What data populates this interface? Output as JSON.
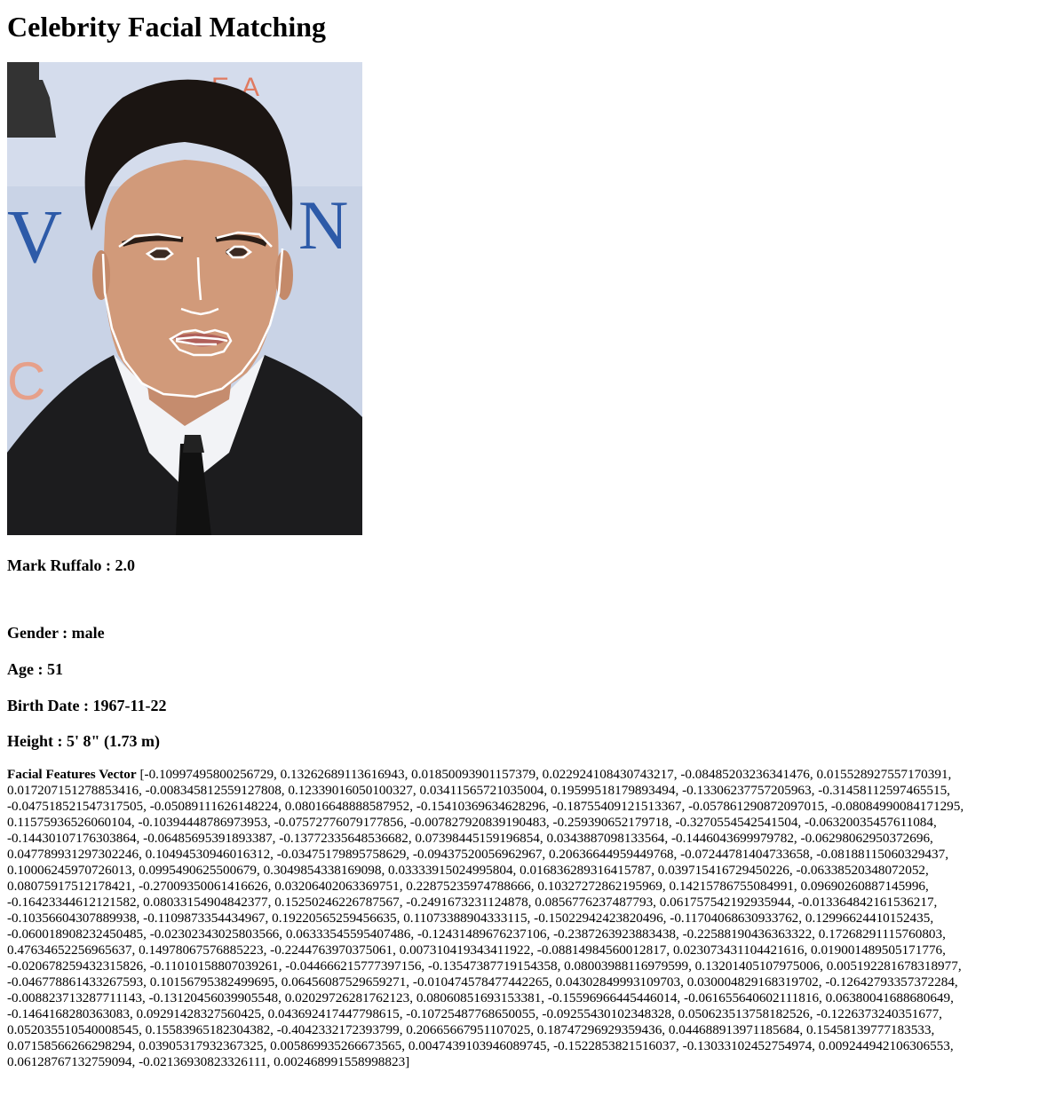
{
  "title": "Celebrity Facial Matching",
  "photo": {
    "alt": "Celebrity photo with facial landmarks",
    "background_text": "EA"
  },
  "match": {
    "name": "Mark Ruffalo",
    "separator": " : ",
    "score": "2.0"
  },
  "gender": {
    "label": "Gender",
    "value": "male"
  },
  "age": {
    "label": "Age",
    "value": "51"
  },
  "birth_date": {
    "label": "Birth Date",
    "value": "1967-11-22"
  },
  "height": {
    "label": "Height",
    "value": "5' 8\" (1.73 m)"
  },
  "features": {
    "label": "Facial Features Vector",
    "vector": "[-0.10997495800256729, 0.13262689113616943, 0.01850093901157379, 0.022924108430743217, -0.08485203236341476, 0.015528927557170391, 0.017207151278853416, -0.008345812559127808, 0.12339016050100327, 0.03411565721035004, 0.19599518179893494, -0.13306237757205963, -0.31458112597465515, -0.047518521547317505, -0.05089111626148224, 0.08016648888587952, -0.15410369634628296, -0.18755409121513367, -0.057861290872097015, -0.08084990084171295, 0.11575936526060104, -0.10394448786973953, -0.07572776079177856, -0.007827920839190483, -0.259390652179718, -0.3270554542541504, -0.06320035457611084, -0.14430107176303864, -0.06485695391893387, -0.13772335648536682, 0.07398445159196854, 0.0343887098133564, -0.1446043699979782, -0.06298062950372696, 0.047789931297302246, 0.10494530946016312, -0.03475179895758629, -0.09437520056962967, 0.20636644959449768, -0.07244781404733658, -0.08188115060329437, 0.10006245970726013, 0.0995490625500679, 0.3049854338169098, 0.03333915024995804, 0.016836289316415787, 0.039715416729450226, -0.06338520348072052, 0.08075917512178421, -0.27009350061416626, 0.03206402063369751, 0.22875235974788666, 0.10327272862195969, 0.14215786755084991, 0.09690260887145996, -0.16423344612121582, 0.08033154904842377, 0.15250246226787567, -0.2491673231124878, 0.0856776237487793, 0.061757542192935944, -0.013364842161536217, -0.10356604307889938, -0.1109873354434967, 0.19220565259456635, 0.11073388904333115, -0.15022942423820496, -0.11704068630933762, 0.12996624410152435, -0.060018908232450485, -0.02302343025803566, 0.06333545595407486, -0.12431489676237106, -0.2387263923883438, -0.22588190436363322, 0.17268291115760803, 0.47634652256965637, 0.14978067576885223, -0.2244763970375061, 0.007310419343411922, -0.08814984560012817, 0.023073431104421616, 0.019001489505171776, -0.020678259432315826, -0.11010158807039261, -0.044666215777397156, -0.13547387719154358, 0.08003988116979599, 0.13201405107975006, 0.005192281678318977, -0.046778861433267593, 0.10156795382499695, 0.06456087529659271, -0.010474578477442265, 0.04302849993109703, 0.030004829168319702, -0.12642793357372284, -0.008823713287711143, -0.13120456039905548, 0.02029726281762123, 0.08060851693153381, -0.15596966445446014, -0.061655640602111816, 0.06380041688680649, -0.1464168280363083, 0.09291428327560425, 0.043692417447798615, -0.10725487768650055, -0.09255430102348328, 0.050623513758182526, -0.1226373240351677, 0.052035510540008545, 0.15583965182304382, -0.4042332172393799, 0.20665667951107025, 0.18747296929359436, 0.044688913971185684, 0.15458139777183533, 0.07158566266298294, 0.03905317932367325, 0.005869935266673565, 0.0047439103946089745, -0.1522853821516037, -0.13033102452754974, 0.009244942106306553, 0.06128767132759094, -0.02136930823326111, 0.002468991558998823]"
  }
}
